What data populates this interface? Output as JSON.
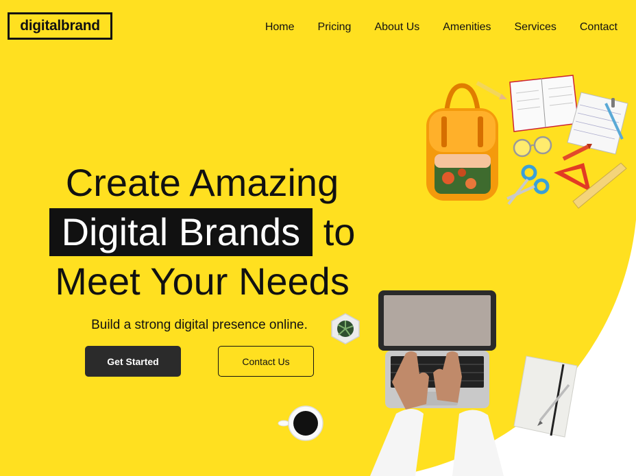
{
  "brand": {
    "logo_text": "digitalbrand"
  },
  "nav": {
    "items": [
      "Home",
      "Pricing",
      "About Us",
      "Amenities",
      "Services",
      "Contact"
    ]
  },
  "hero": {
    "line1": "Create Amazing",
    "line2_highlight": "Digital Brands",
    "line2_rest": "to",
    "line3": "Meet Your Needs",
    "subtitle": "Build a strong digital presence online.",
    "primary_button": "Get Started",
    "secondary_button": "Contact Us"
  },
  "colors": {
    "background": "#ffe020",
    "text": "#111111",
    "primary_button": "#2b2b2b"
  },
  "illustrations": [
    "backpack-image",
    "notebook-image",
    "paper-image",
    "glasses-image",
    "scissors-image",
    "triangle-ruler-image",
    "plant-image",
    "laptop-image",
    "hands-image",
    "coffee-cup-image",
    "notepad-image",
    "pencil-image"
  ]
}
